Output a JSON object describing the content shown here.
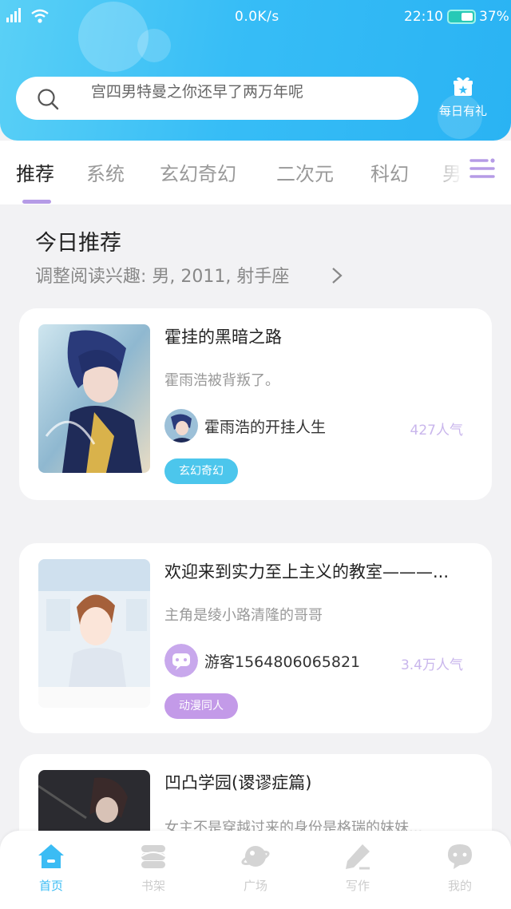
{
  "status_bar": {
    "net_speed": "0.0K/s",
    "time": "22:10",
    "battery": "37%"
  },
  "search": {
    "placeholder": "宫四男特曼之你还早了两万年呢"
  },
  "daily_gift": {
    "label": "每日有礼",
    "icon": "gift-icon"
  },
  "tabs": [
    {
      "label": "推荐",
      "active": true
    },
    {
      "label": "系统",
      "active": false
    },
    {
      "label": "玄幻奇幻",
      "active": false
    },
    {
      "label": "二次元",
      "active": false
    },
    {
      "label": "科幻",
      "active": false
    },
    {
      "label": "男",
      "active": false
    }
  ],
  "section": {
    "title": "今日推荐",
    "subtitle": "调整阅读兴趣: 男, 2011, 射手座"
  },
  "books": [
    {
      "title": "霍挂的黑暗之路",
      "desc": "霍雨浩被背叛了。",
      "author": "霍雨浩的开挂人生",
      "popularity": "427人气",
      "tag": "玄幻奇幻",
      "tag_color": "#4cc6ec"
    },
    {
      "title": "欢迎来到实力至上主义的教室———...",
      "desc": "主角是绫小路清隆的哥哥",
      "author": "游客1564806065821",
      "popularity": "3.4万人气",
      "tag": "动漫同人",
      "tag_color": "#c39ae8"
    },
    {
      "title": "凹凸学园(谡谬症篇)",
      "desc": "女主不是穿越过来的身份是格瑞的妹妹..."
    }
  ],
  "bottom_nav": [
    {
      "label": "首页",
      "icon": "home-icon",
      "active": true
    },
    {
      "label": "书架",
      "icon": "bookshelf-icon",
      "active": false
    },
    {
      "label": "广场",
      "icon": "planet-icon",
      "active": false
    },
    {
      "label": "写作",
      "icon": "pen-icon",
      "active": false
    },
    {
      "label": "我的",
      "icon": "chat-bubble-icon",
      "active": false
    }
  ],
  "colors": {
    "header": "#37bdf6",
    "accent_purple": "#b59be6",
    "nav_active": "#3bbcf4"
  }
}
